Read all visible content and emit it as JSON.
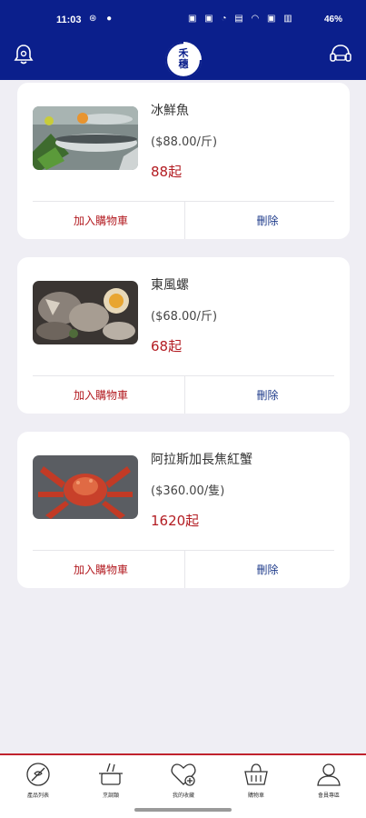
{
  "status_bar": {
    "time": "11:03",
    "left_icons": "⊛ ●",
    "right_icons": "▣ ▣ ◔ ▤ ◠ ▣ ▥",
    "battery": "46%"
  },
  "header": {
    "left_icon": "bell-icon",
    "right_icon": "customer-service-icon",
    "logo_text_line1": "禾",
    "logo_text_line2": "穗"
  },
  "items": [
    {
      "name": "冰鮮魚",
      "price": "($88.00/斤)",
      "total": "88起",
      "add_label": "加入購物車",
      "delete_label": "刪除",
      "image": "fish-photo"
    },
    {
      "name": "東風螺",
      "price": "($68.00/斤)",
      "total": "68起",
      "add_label": "加入購物車",
      "delete_label": "刪除",
      "image": "snail-photo"
    },
    {
      "name": "阿拉斯加長焦紅蟹",
      "price": "($360.00/隻)",
      "total": "1620起",
      "add_label": "加入購物車",
      "delete_label": "刪除",
      "image": "crab-photo"
    }
  ],
  "bottom_nav": [
    {
      "label": "產品列表",
      "icon": "product-list-icon"
    },
    {
      "label": "烹調類",
      "icon": "cooking-icon"
    },
    {
      "label": "我的收藏",
      "icon": "favorites-icon"
    },
    {
      "label": "購物車",
      "icon": "cart-icon"
    },
    {
      "label": "會員專區",
      "icon": "member-icon"
    }
  ],
  "colors": {
    "brand_blue": "#0b1f8c",
    "accent_red": "#b31c22",
    "background": "#efeef4"
  }
}
